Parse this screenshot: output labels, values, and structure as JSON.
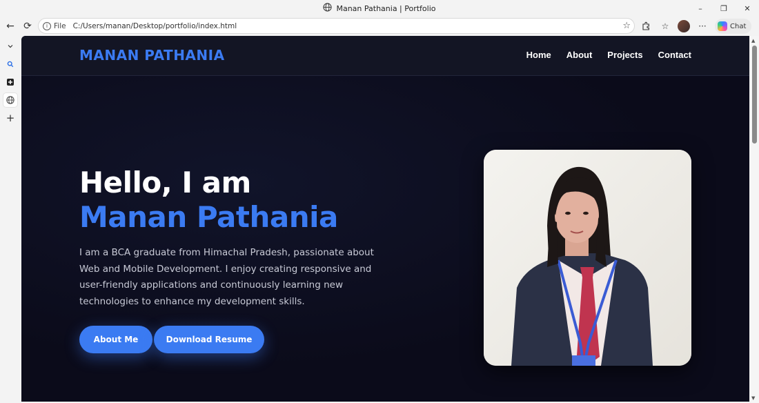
{
  "window": {
    "title": "Manan Pathania | Portfolio",
    "minimize": "–",
    "restore": "❐",
    "close": "✕"
  },
  "browser": {
    "back": "←",
    "reload": "⟳",
    "info": "i",
    "scheme": "File",
    "url": "C:/Users/manan/Desktop/portfolio/index.html",
    "chat_label": "Chat",
    "more": "···"
  },
  "sidebar": {
    "items": [
      {
        "icon": "chevron-down-icon",
        "glyph": "⌄"
      },
      {
        "icon": "search-icon",
        "glyph": "🔍"
      },
      {
        "icon": "toolbox-icon",
        "glyph": "✚"
      },
      {
        "icon": "globe-icon",
        "glyph": "🌐"
      },
      {
        "icon": "add-icon",
        "glyph": "+"
      }
    ]
  },
  "site": {
    "brand": "MANAN PATHANIA",
    "nav": [
      "Home",
      "About",
      "Projects",
      "Contact"
    ],
    "hero": {
      "greeting": "Hello, I am",
      "name": "Manan Pathania",
      "description": "I am a BCA graduate from Himachal Pradesh, passionate about Web and Mobile Development. I enjoy creating responsive and user-friendly applications and continuously learning new technologies to enhance my development skills.",
      "buttons": [
        "About Me",
        "Download Resume"
      ]
    }
  },
  "colors": {
    "accent": "#3b7bf2",
    "page_bg": "#0b0b1a",
    "nav_bg": "#131524",
    "text": "#ffffff",
    "muted": "#c8cad6"
  }
}
